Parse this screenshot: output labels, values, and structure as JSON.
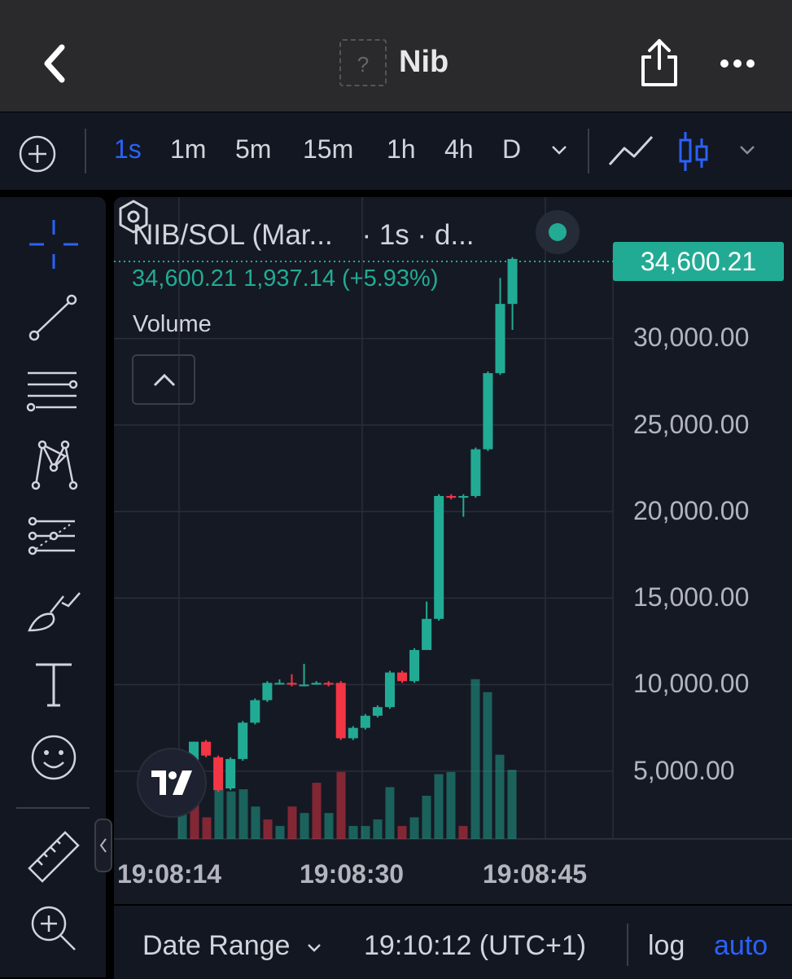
{
  "header": {
    "token_placeholder": "?",
    "token_name": "Nib",
    "back_icon": "chevron-left-icon",
    "share_icon": "share-icon",
    "more_icon": "more-horizontal-icon"
  },
  "toolbar": {
    "intervals": [
      "1s",
      "1m",
      "5m",
      "15m",
      "1h",
      "4h",
      "D"
    ],
    "active_interval": "1s"
  },
  "sidebar": {
    "tools": [
      "crosshair-icon",
      "trend-line-icon",
      "fib-retracement-icon",
      "pattern-icon",
      "projection-icon",
      "brush-icon",
      "text-icon",
      "emoji-icon",
      "ruler-icon",
      "zoom-in-icon"
    ]
  },
  "chart_header": {
    "symbol": "NIB/SOL (Mar...",
    "interval_text": "· 1s · d...",
    "ohlc": "34,600.21  1,937.14 (+5.93%)",
    "volume_label": "Volume"
  },
  "price_tag": "34,600.21",
  "colors": {
    "up": "#22ab94",
    "down": "#f23645",
    "accent": "#2962ff",
    "bg": "#151924"
  },
  "chart_data": {
    "type": "candlestick",
    "y_ticks": [
      "30,000.00",
      "25,000.00",
      "20,000.00",
      "15,000.00",
      "10,000.00",
      "5,000.00"
    ],
    "x_ticks": [
      "19:08:14",
      "19:08:30",
      "19:08:45"
    ],
    "ylim": [
      0,
      35000
    ],
    "last_price": 34600.21,
    "candles": [
      {
        "o": 5500,
        "c": 6700,
        "h": 6700,
        "l": 5000
      },
      {
        "o": 6700,
        "c": 5900,
        "h": 6800,
        "l": 5800
      },
      {
        "o": 5800,
        "c": 3900,
        "h": 5900,
        "l": 3800
      },
      {
        "o": 4000,
        "c": 5700,
        "h": 5800,
        "l": 3900
      },
      {
        "o": 5700,
        "c": 7800,
        "h": 7900,
        "l": 5600
      },
      {
        "o": 7800,
        "c": 9100,
        "h": 9200,
        "l": 7700
      },
      {
        "o": 9100,
        "c": 10100,
        "h": 10200,
        "l": 9000
      },
      {
        "o": 10100,
        "c": 10100,
        "h": 10300,
        "l": 10000
      },
      {
        "o": 10100,
        "c": 10000,
        "h": 10600,
        "l": 9900
      },
      {
        "o": 10000,
        "c": 10000,
        "h": 11200,
        "l": 9900
      },
      {
        "o": 10000,
        "c": 10100,
        "h": 10200,
        "l": 10000
      },
      {
        "o": 10100,
        "c": 10000,
        "h": 10200,
        "l": 9900
      },
      {
        "o": 10100,
        "c": 6900,
        "h": 10200,
        "l": 6800
      },
      {
        "o": 6900,
        "c": 7500,
        "h": 7600,
        "l": 6800
      },
      {
        "o": 7500,
        "c": 8200,
        "h": 8300,
        "l": 7400
      },
      {
        "o": 8200,
        "c": 8700,
        "h": 8800,
        "l": 8100
      },
      {
        "o": 8700,
        "c": 10700,
        "h": 10800,
        "l": 8600
      },
      {
        "o": 10700,
        "c": 10200,
        "h": 10800,
        "l": 10100
      },
      {
        "o": 10200,
        "c": 12000,
        "h": 12100,
        "l": 10100
      },
      {
        "o": 12000,
        "c": 13800,
        "h": 14800,
        "l": 13700
      },
      {
        "o": 13800,
        "c": 20900,
        "h": 21000,
        "l": 13700
      },
      {
        "o": 20900,
        "c": 20800,
        "h": 21000,
        "l": 20700
      },
      {
        "o": 20800,
        "c": 20900,
        "h": 21000,
        "l": 19700
      },
      {
        "o": 20900,
        "c": 23600,
        "h": 23700,
        "l": 20800
      },
      {
        "o": 23600,
        "c": 28000,
        "h": 28100,
        "l": 23500
      },
      {
        "o": 28000,
        "c": 32000,
        "h": 33500,
        "l": 27900
      },
      {
        "o": 32000,
        "c": 34600,
        "h": 34700,
        "l": 30500
      }
    ],
    "volume": [
      1.2,
      2.5,
      1.0,
      2.3,
      2.2,
      2.3,
      1.5,
      0.9,
      0.6,
      1.5,
      1.2,
      2.6,
      1.2,
      3.1,
      0.6,
      0.6,
      0.9,
      2.4,
      0.6,
      1.0,
      2.0,
      3.0,
      3.1,
      0.6,
      7.4,
      6.8,
      3.9,
      3.2
    ],
    "volume_up": [
      true,
      false,
      false,
      true,
      true,
      true,
      true,
      false,
      true,
      false,
      true,
      false,
      true,
      false,
      true,
      true,
      true,
      true,
      false,
      true,
      true,
      true,
      true,
      false,
      true,
      true,
      true,
      true
    ]
  },
  "bottom": {
    "date_range": "Date Range",
    "time": "19:10:12 (UTC+1)",
    "log": "log",
    "auto": "auto"
  }
}
